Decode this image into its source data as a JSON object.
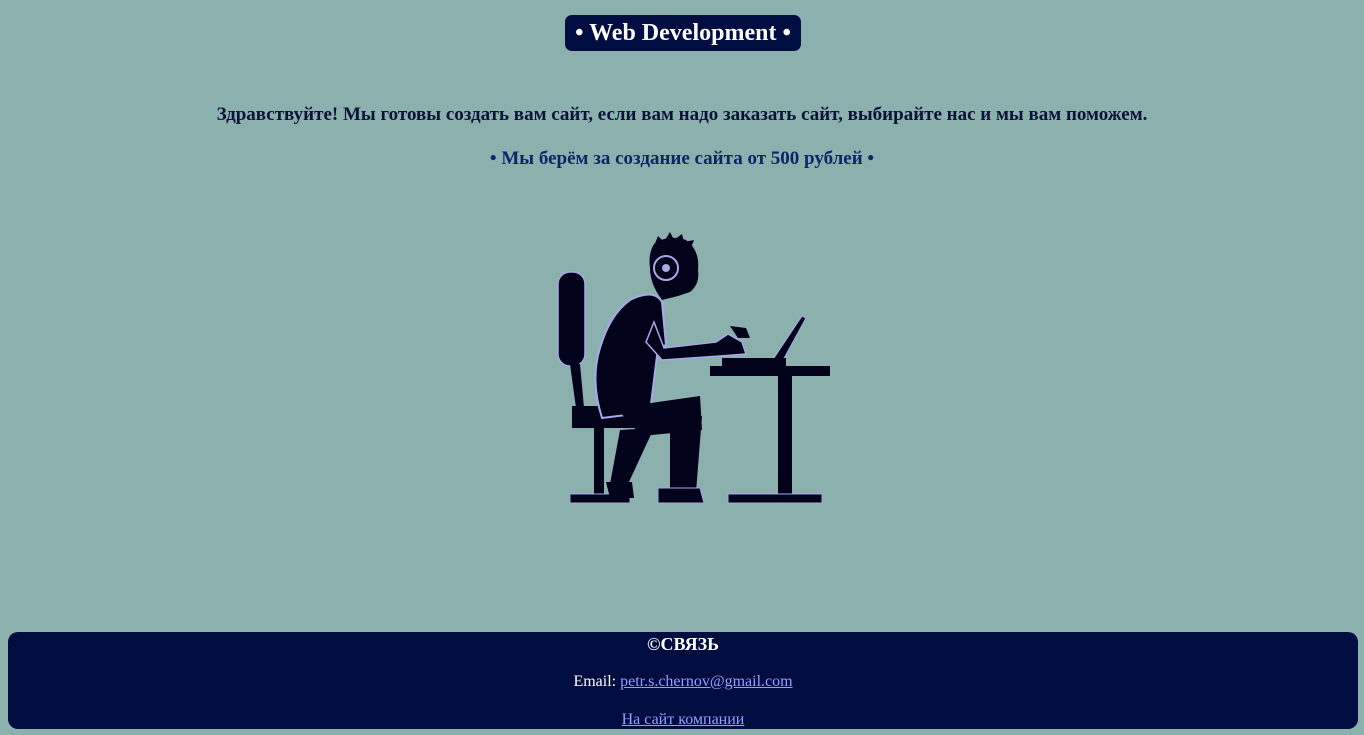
{
  "header": {
    "title": "• Web Development •"
  },
  "main": {
    "greeting": "Здравствуйте! Мы готовы создать вам сайт, если вам надо заказать сайт, выбирайте нас и мы вам поможем.",
    "price": "• Мы берём за создание сайта от 500 рублей •"
  },
  "illustration": {
    "icon": "person-at-laptop-icon"
  },
  "footer": {
    "title": "©СВЯЗЬ",
    "email_label": "Email: ",
    "email": "petr.s.chernov@gmail.com",
    "company_link": "На сайт компании"
  },
  "colors": {
    "background": "#8cb0ae",
    "navy": "#000d40",
    "link": "#9c9cff"
  }
}
